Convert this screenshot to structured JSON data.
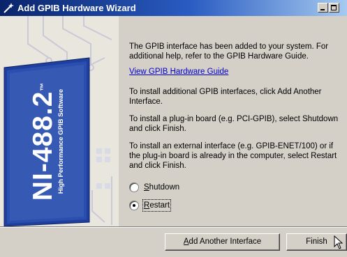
{
  "window": {
    "title": "Add GPIB Hardware Wizard"
  },
  "banner": {
    "product_name": "NI-488.2",
    "trademark": "™",
    "tagline": "High Performance GPIB Software"
  },
  "content": {
    "intro": "The GPIB interface has been added to your system. For additional help, refer to the GPIB Hardware Guide.",
    "guide_link": "View GPIB Hardware Guide",
    "add_interfaces_text": "To install additional GPIB interfaces, click Add Another Interface.",
    "plugin_board_text": "To install a plug-in board (e.g. PCI-GPIB), select Shutdown and click Finish.",
    "external_interface_text": "To install an external interface (e.g. GPIB-ENET/100) or if the plug-in board is already in the computer, select Restart and click Finish."
  },
  "options": {
    "shutdown": {
      "mnemonic": "S",
      "rest": "hutdown",
      "selected": false
    },
    "restart": {
      "mnemonic": "R",
      "rest": "estart",
      "selected": true
    }
  },
  "buttons": {
    "add_another": {
      "mnemonic": "A",
      "rest": "dd Another Interface"
    },
    "finish": "Finish"
  },
  "colors": {
    "title_bar_start": "#0a246a",
    "title_bar_end": "#a6caf0",
    "banner_blue": "#1f3f9c",
    "link": "#0000cc",
    "dialog_face": "#d4d0c8"
  },
  "icons": {
    "title": "wizard-wand-icon",
    "cursor": "arrow-pointer-icon"
  }
}
